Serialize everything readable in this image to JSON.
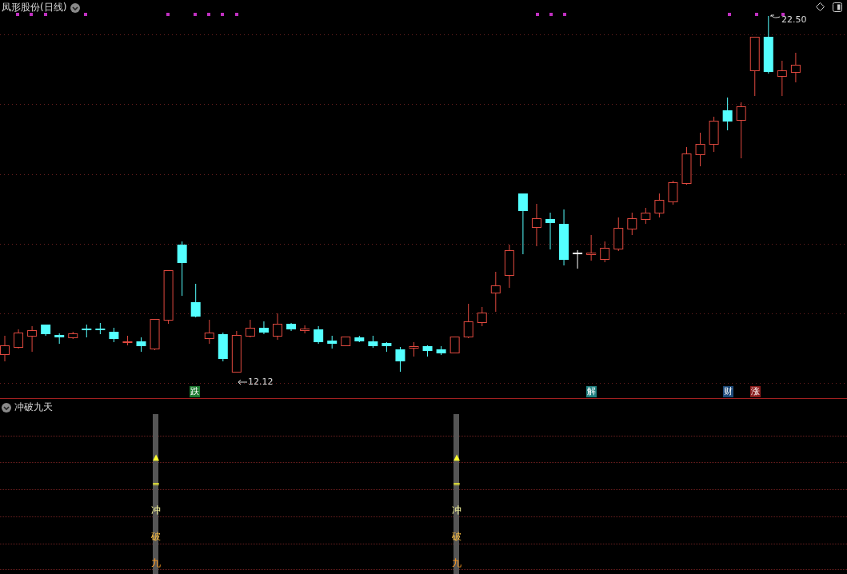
{
  "chart_title": "凤形股份(日线)",
  "price_chart": {
    "high_label": "22.50",
    "low_label": "12.12"
  },
  "signals": [
    {
      "label": "跌",
      "color": "#1c7a30"
    },
    {
      "label": "解",
      "color": "#1f8080"
    },
    {
      "label": "财",
      "color": "#1d4a7a"
    },
    {
      "label": "涨",
      "color": "#8a1c1c"
    }
  ],
  "indicator": {
    "title": "冲破九天",
    "markers": [
      {
        "labels": [
          "▲",
          "=",
          "冲",
          "破",
          "九"
        ]
      },
      {
        "labels": [
          "▲",
          "=",
          "冲",
          "破",
          "九"
        ]
      }
    ]
  }
}
